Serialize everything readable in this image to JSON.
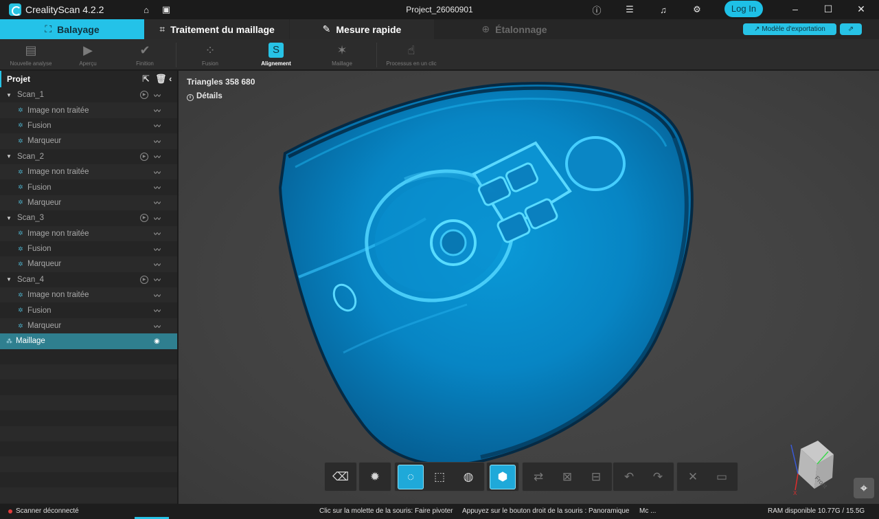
{
  "app": {
    "title": "CrealityScan 4.2.2",
    "project": "Project_26060901",
    "login_label": "Log In"
  },
  "tabs": [
    {
      "label": "Balayage",
      "icon": "scan-frame-icon",
      "state": "active"
    },
    {
      "label": "Traitement du maillage",
      "icon": "crop-icon",
      "state": "normal"
    },
    {
      "label": "Mesure rapide",
      "icon": "ruler-icon",
      "state": "normal"
    },
    {
      "label": "Étalonnage",
      "icon": "crosshair-icon",
      "state": "disabled"
    }
  ],
  "export": {
    "label": "Modèle d'exportation",
    "share_icon": "share-icon"
  },
  "ribbon": [
    {
      "label": "Nouvelle analyse",
      "icon": "new-scan-icon"
    },
    {
      "label": "Aperçu",
      "icon": "preview-icon"
    },
    {
      "label": "Finition",
      "icon": "check-icon"
    },
    {
      "label": "Fusion",
      "icon": "fusion-icon"
    },
    {
      "label": "Alignement",
      "icon": "alignment-icon",
      "active": true
    },
    {
      "label": "Maillage",
      "icon": "mesh-icon"
    },
    {
      "label": "Processus en un clic",
      "icon": "one-click-icon"
    }
  ],
  "sidebar": {
    "title": "Projet",
    "scans": [
      {
        "name": "Scan_1",
        "children": [
          "Image non traitée",
          "Fusion",
          "Marqueur"
        ]
      },
      {
        "name": "Scan_2",
        "children": [
          "Image non traitée",
          "Fusion",
          "Marqueur"
        ]
      },
      {
        "name": "Scan_3",
        "children": [
          "Image non traitée",
          "Fusion",
          "Marqueur"
        ]
      },
      {
        "name": "Scan_4",
        "children": [
          "Image non traitée",
          "Fusion",
          "Marqueur"
        ]
      }
    ],
    "mesh_label": "Maillage"
  },
  "viewport": {
    "triangles": "Triangles 358 680",
    "details": "Détails",
    "model_color": "#0a8fd0",
    "cube_label": "Front"
  },
  "bottom_tools": [
    [
      "eraser-icon",
      "light-icon"
    ],
    [
      "lasso-select-icon",
      "rect-select-icon",
      "brush-select-icon"
    ],
    [
      "view-through-icon"
    ],
    [
      "invert-selection-icon",
      "deselect-icon",
      "delete-selection-icon"
    ],
    [
      "undo-icon",
      "redo-icon"
    ],
    [
      "cancel-icon",
      "save-icon"
    ]
  ],
  "status": {
    "scanner": "Scanner déconnecté",
    "hint1": "Clic sur la molette de la souris: Faire pivoter",
    "hint2": "Appuyez sur le bouton droit de la souris : Panoramique",
    "hint3": "Mc ...",
    "ram": "RAM disponible 10.77G / 15.5G"
  },
  "colors": {
    "accent": "#27c3e6",
    "status_error": "#e23b3b"
  }
}
